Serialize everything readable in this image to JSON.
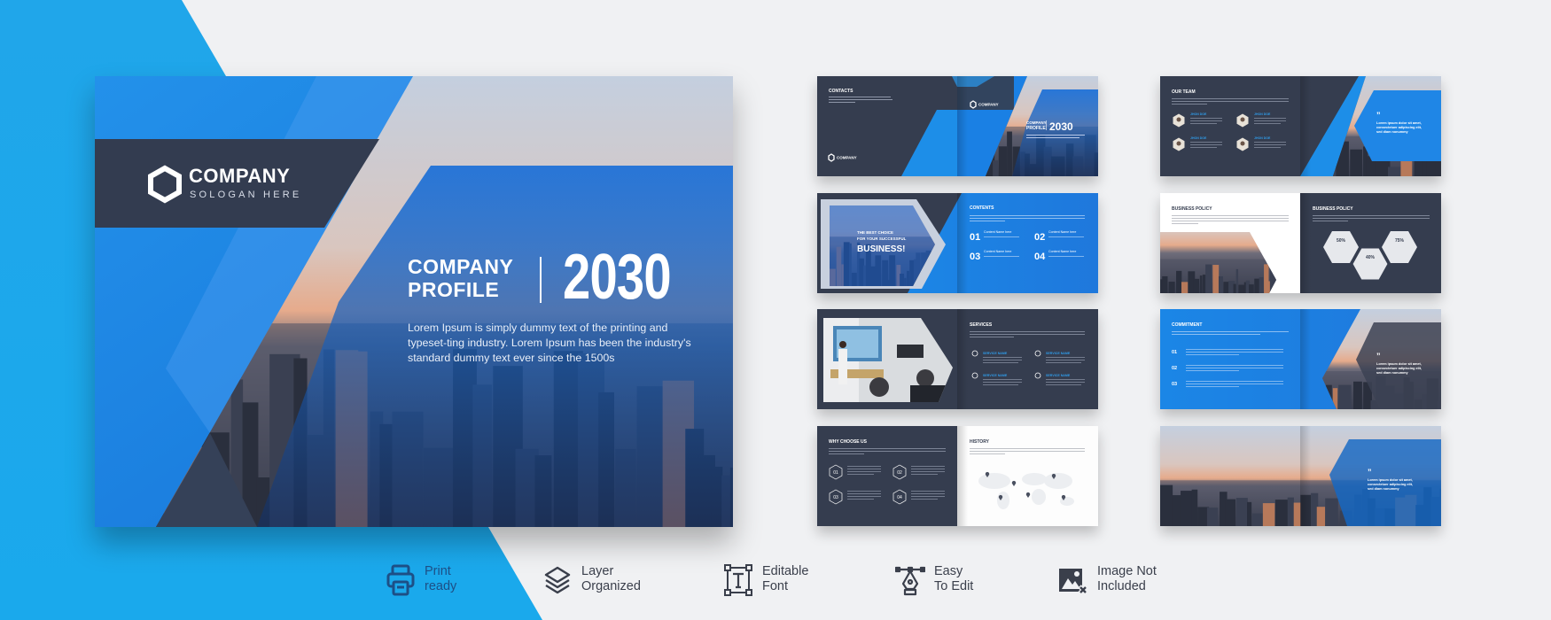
{
  "colors": {
    "accent_blue": "#1e86e4",
    "navy": "#353d4f",
    "background": "#f0f1f3",
    "link_blue": "#2f9be8"
  },
  "cover": {
    "logo_name": "COMPANY",
    "logo_slogan": "SOLOGAN HERE",
    "title_line1": "COMPANY",
    "title_line2": "PROFILE",
    "year": "2030",
    "paragraph": "Lorem Ipsum is simply dummy text of the printing and typeset-ting industry. Lorem Ipsum has been the industry's standard dummy text ever since the 1500s"
  },
  "thumbs": {
    "contacts": {
      "title": "CONTACTS",
      "logo": "COMPANY",
      "right_logo": "COMPANY",
      "profile1": "COMPANY",
      "profile2": "PROFILE",
      "year": "2030"
    },
    "contents": {
      "tag1": "THE BEST CHOICE",
      "tag2": "FOR YOUR SUCCESSFUL",
      "tag3": "BUSINESS!",
      "title": "CONTENTS",
      "items": [
        {
          "num": "01",
          "label": "Content Name here"
        },
        {
          "num": "02",
          "label": "Content Name here"
        },
        {
          "num": "03",
          "label": "Content Name here"
        },
        {
          "num": "04",
          "label": "Content Name here"
        }
      ]
    },
    "services": {
      "title": "SERVICES",
      "items": [
        "SERVICE NAME",
        "SERVICE NAME",
        "SERVICE NAME",
        "SERVICE NAME"
      ]
    },
    "why": {
      "title": "WHY CHOOSE US",
      "items": [
        "01",
        "02",
        "03",
        "04"
      ],
      "history_title": "HISTORY"
    },
    "team": {
      "title": "OUR TEAM",
      "members": [
        "JHON DOE",
        "JHON DOE",
        "JHON DOE",
        "JHON DOE"
      ],
      "quote": [
        "Lorem ipsum dolor sit amet,",
        "consectetuer adipiscing elit,",
        "sed diam nonummy"
      ]
    },
    "policy": {
      "title_left": "BUSINESS POLICY",
      "title_right": "BUSINESS POLICY",
      "stats": [
        "50%",
        "40%",
        "75%"
      ]
    },
    "commitment": {
      "title": "COMMITMENT",
      "items": [
        "01",
        "02",
        "03"
      ],
      "quote": [
        "Lorem ipsum dolor sit amet,",
        "consectetuer adipiscing elit,",
        "sed diam nonummy"
      ]
    },
    "closing": {
      "quote": [
        "Lorem ipsum dolor sit amet,",
        "consectetuer adipiscing elit,",
        "sed diam nonummy"
      ]
    }
  },
  "features": [
    {
      "icon": "printer-icon",
      "line1": "Print",
      "line2": "ready"
    },
    {
      "icon": "layers-icon",
      "line1": "Layer",
      "line2": "Organized"
    },
    {
      "icon": "text-box-icon",
      "line1": "Editable",
      "line2": "Font"
    },
    {
      "icon": "pen-tool-icon",
      "line1": "Easy",
      "line2": "To Edit"
    },
    {
      "icon": "image-off-icon",
      "line1": "Image Not",
      "line2": "Included"
    }
  ]
}
